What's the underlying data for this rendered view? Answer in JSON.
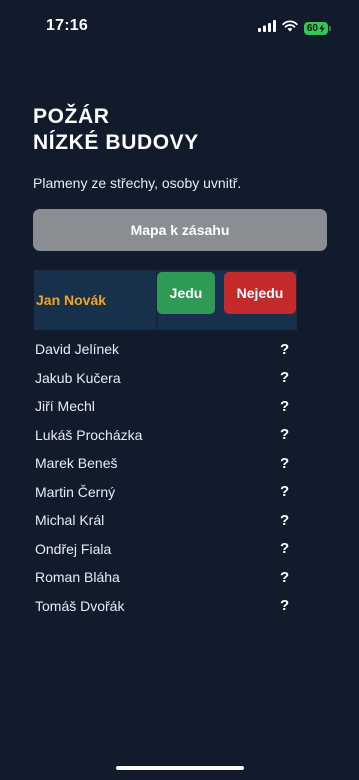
{
  "status_bar": {
    "time": "17:16",
    "battery_level": "60",
    "icons": [
      "signal-icon",
      "wifi-icon",
      "battery-icon"
    ],
    "battery_color": "#32c759"
  },
  "incident": {
    "title_line1": "POŽÁR",
    "title_line2": "NÍZKÉ BUDOVY",
    "description": "Plameny ze střechy, osoby uvnitř."
  },
  "map_button": {
    "label": "Mapa k zásahu"
  },
  "current_user": {
    "name": "Jan Novák",
    "name_color": "#f3a51c",
    "go_label": "Jedu",
    "go_color": "#2f9a55",
    "nogo_label": "Nejedu",
    "nogo_color": "#c52a2b"
  },
  "members": [
    {
      "name": "David Jelínek",
      "status": "?"
    },
    {
      "name": "Jakub Kučera",
      "status": "?"
    },
    {
      "name": "Jiří Mechl",
      "status": "?"
    },
    {
      "name": "Lukáš Procházka",
      "status": "?"
    },
    {
      "name": "Marek Beneš",
      "status": "?"
    },
    {
      "name": "Martin Černý",
      "status": "?"
    },
    {
      "name": "Michal Král",
      "status": "?"
    },
    {
      "name": "Ondřej Fiala",
      "status": "?"
    },
    {
      "name": "Roman Bláha",
      "status": "?"
    },
    {
      "name": "Tomáš Dvořák",
      "status": "?"
    }
  ]
}
